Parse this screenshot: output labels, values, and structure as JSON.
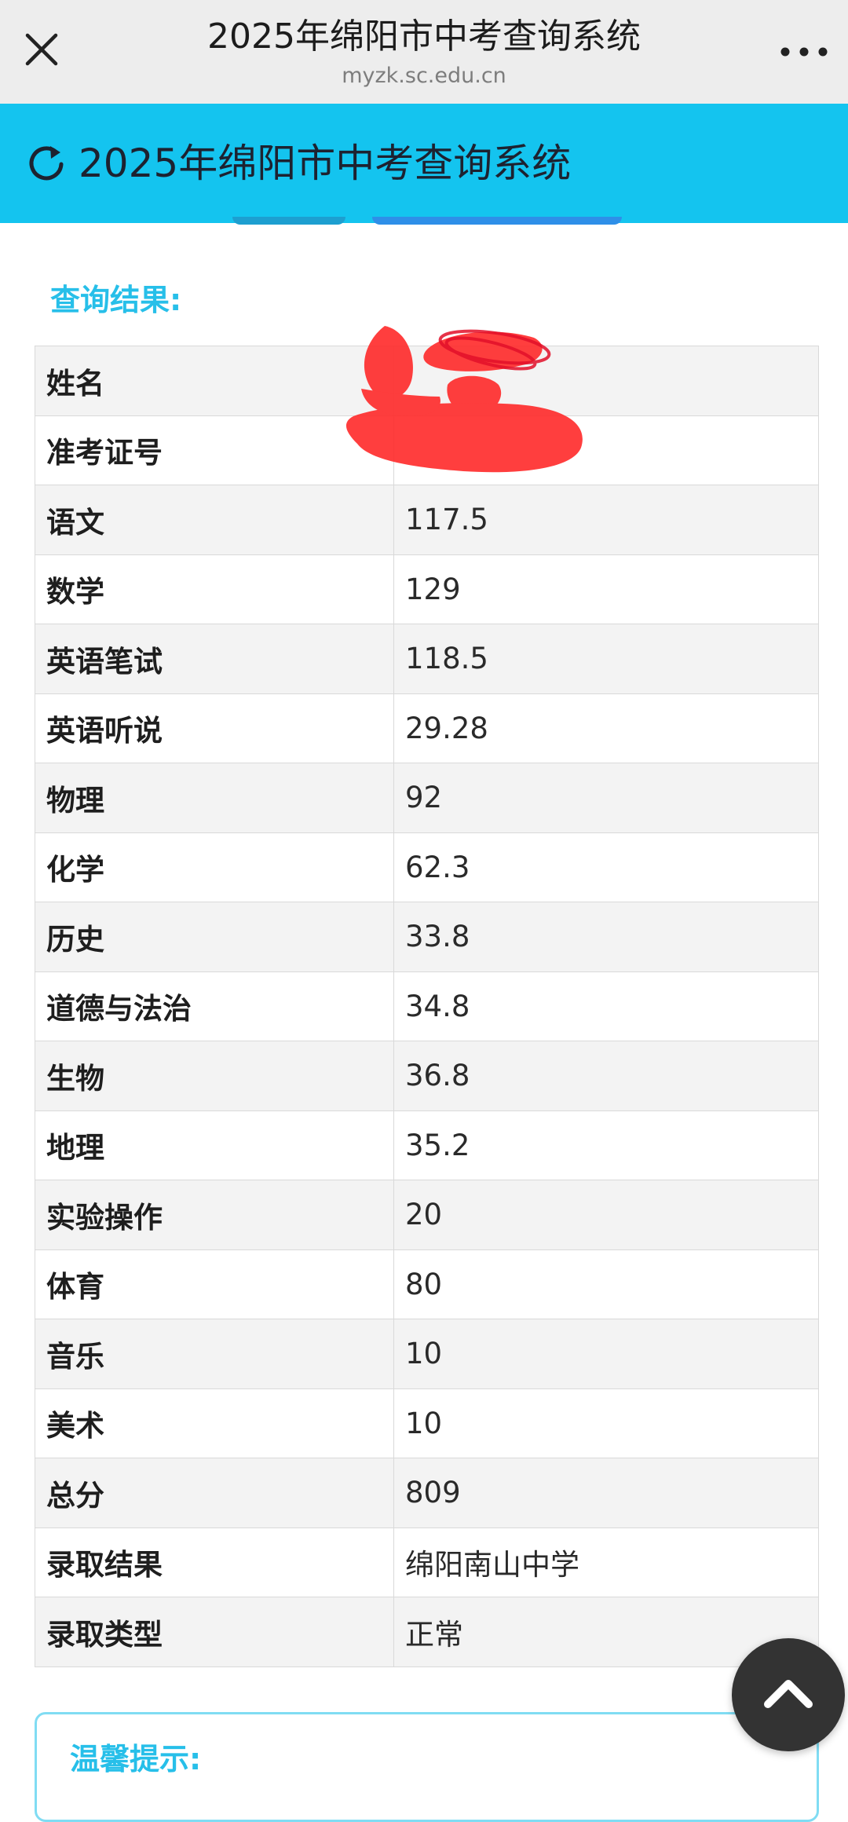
{
  "browser": {
    "title": "2025年绵阳市中考查询系统",
    "url": "myzk.sc.edu.cn",
    "close_icon": "close-icon",
    "more_icon": "more-icon"
  },
  "banner": {
    "title": "2025年绵阳市中考查询系统",
    "icon": "refresh-icon",
    "color": "#14c4ef"
  },
  "results": {
    "heading": "查询结果:",
    "rows": [
      {
        "label": "姓名",
        "value": ""
      },
      {
        "label": "准考证号",
        "value": ""
      },
      {
        "label": "语文",
        "value": "117.5"
      },
      {
        "label": "数学",
        "value": "129"
      },
      {
        "label": "英语笔试",
        "value": "118.5"
      },
      {
        "label": "英语听说",
        "value": "29.28"
      },
      {
        "label": "物理",
        "value": "92"
      },
      {
        "label": "化学",
        "value": "62.3"
      },
      {
        "label": "历史",
        "value": "33.8"
      },
      {
        "label": "道德与法治",
        "value": "34.8"
      },
      {
        "label": "生物",
        "value": "36.8"
      },
      {
        "label": "地理",
        "value": "35.2"
      },
      {
        "label": "实验操作",
        "value": "20"
      },
      {
        "label": "体育",
        "value": "80"
      },
      {
        "label": "音乐",
        "value": "10"
      },
      {
        "label": "美术",
        "value": "10"
      },
      {
        "label": "总分",
        "value": "809"
      },
      {
        "label": "录取结果",
        "value": "绵阳南山中学"
      },
      {
        "label": "录取类型",
        "value": "正常"
      }
    ]
  },
  "tips": {
    "heading": "温馨提示:"
  },
  "scroll_top": {
    "icon": "chevron-up-icon"
  },
  "colors": {
    "accent": "#14c4ef",
    "heading": "#27bfe9",
    "redaction": "#ff2a2a"
  }
}
